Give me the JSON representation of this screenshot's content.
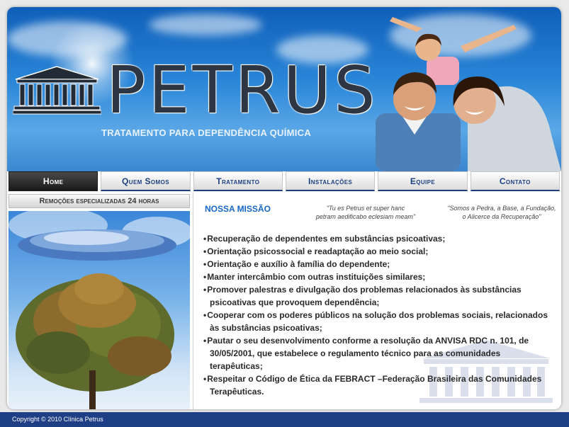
{
  "header": {
    "brand": "PETRUS",
    "tagline": "TRATAMENTO PARA DEPENDÊNCIA QUÍMICA"
  },
  "nav": [
    {
      "label": "Home",
      "active": true
    },
    {
      "label": "Quem Somos"
    },
    {
      "label": "Tratamento"
    },
    {
      "label": "Instalações"
    },
    {
      "label": "Equipe"
    },
    {
      "label": "Contato"
    }
  ],
  "sidebar": {
    "remocoes": "Remoções especializadas 24 horas"
  },
  "main": {
    "mission_title": "NOSSA MISSÃO",
    "quote1_line1": "\"Tu es Petrus et super hanc",
    "quote1_line2": "petram aedificabo eclesiam meam\"",
    "quote2_line1": "\"Somos a Pedra, a Base, a Fundação,",
    "quote2_line2": "o Alicerce da Recuperação\"",
    "mission_items": [
      "Recuperação de dependentes em substâncias psicoativas;",
      "Orientação psicossocial e readaptação ao meio social;",
      "Orientação e auxílio à família do dependente;",
      "Manter intercâmbio com outras instituições similares;",
      "Promover palestras e divulgação dos problemas relacionados às substâncias psicoativas que provoquem dependência;",
      "Cooperar com os poderes públicos na solução dos problemas sociais, relacionados às substâncias psicoativas;",
      "Pautar o seu desenvolvimento conforme a resolução da ANVISA RDC n. 101, de 30/05/2001, que estabelece o regulamento técnico para as comunidades terapêuticas;",
      "Respeitar o Código de Ética da FEBRACT –Federação Brasileira das Comunidades Terapêuticas."
    ]
  },
  "footer": {
    "copyright": "Copyright © 2010 Clínica Petrus"
  },
  "colors": {
    "nav_text": "#1c3f82",
    "mission_title": "#1767c5",
    "footer_bg": "#1e3f86"
  }
}
